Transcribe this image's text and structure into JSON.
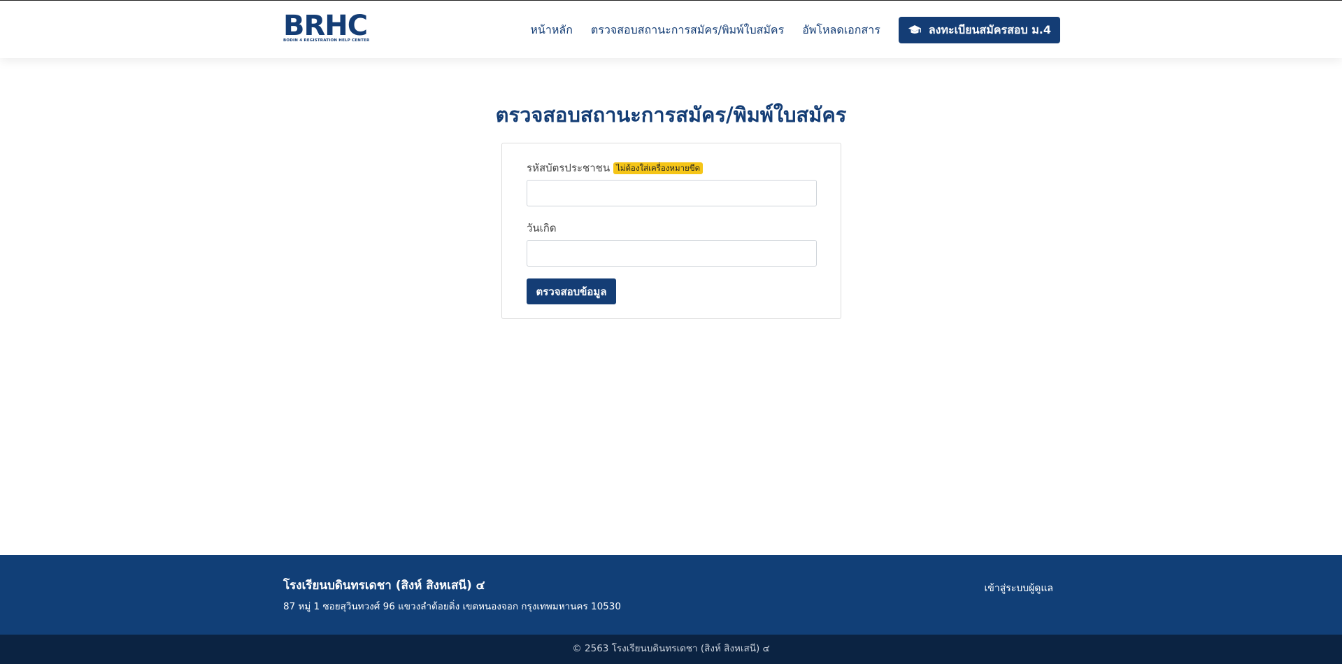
{
  "header": {
    "logo_text": "BRHC",
    "logo_subtext": "BODIN 4 REGISTRATION HELP CENTER",
    "nav": [
      {
        "label": "หน้าหลัก"
      },
      {
        "label": "ตรวจสอบสถานะการสมัคร/พิมพ์ใบสมัคร"
      },
      {
        "label": "อัพโหลดเอกสาร"
      }
    ],
    "cta_label": "ลงทะเบียนสมัครสอบ ม.4",
    "cta_icon": "graduation-cap-icon"
  },
  "main": {
    "title": "ตรวจสอบสถานะการสมัคร/พิมพ์ใบสมัคร",
    "id_label": "รหัสบัตรประชาชน",
    "id_badge": "ไม่ต้องใส่เครื่องหมายขีด",
    "id_value": "",
    "birthdate_label": "วันเกิด",
    "birthdate_value": "",
    "submit_label": "ตรวจสอบข้อมูล"
  },
  "footer": {
    "school_name": "โรงเรียนบดินทรเดชา (สิงห์ สิงหเสนี) ๔",
    "address": "87 หมู่ 1 ซอยสุวินทวงศ์ 96 แขวงลำต้อยติ่ง เขตหนองจอก กรุงเทพมหานคร 10530",
    "admin_link": "เข้าสู่ระบบผู้ดูแล",
    "copyright": "© 2563 โรงเรียนบดินทรเดชา (สิงห์ สิงหเสนี) ๔"
  },
  "colors": {
    "primary": "#143d75",
    "footer_bg": "#113f77",
    "bottom_bar_bg": "#0b2342",
    "badge": "#f5c518"
  }
}
